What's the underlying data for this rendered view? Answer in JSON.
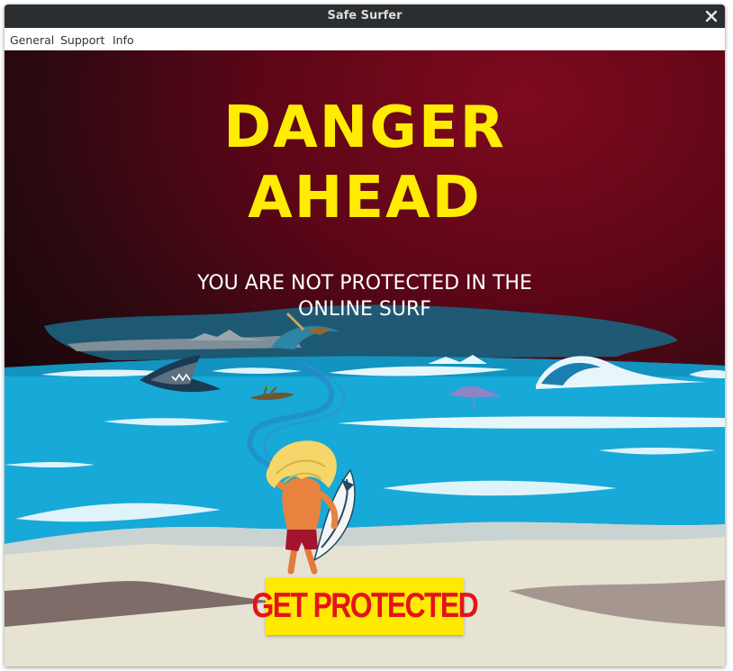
{
  "window": {
    "title": "Safe Surfer"
  },
  "menu": {
    "general": "General",
    "support": "Support",
    "info": "Info"
  },
  "hero": {
    "headline_line1": "DANGER",
    "headline_line2": "AHEAD",
    "subtitle_line1": "YOU ARE NOT PROTECTED IN THE",
    "subtitle_line2": "ONLINE SURF"
  },
  "cta": {
    "label": "GET PROTECTED"
  },
  "colors": {
    "headline": "#ffec00",
    "background_dark": "#120608",
    "background_red": "#7f0a1f",
    "ocean": "#1aa9d8",
    "cta_background": "#ffea00",
    "cta_text": "#e4141b"
  },
  "illustration": {
    "icons": [
      "shark-icon",
      "surfer-icon",
      "surfboard-icon",
      "wave-icon",
      "log-icon",
      "stingray-icon"
    ]
  }
}
